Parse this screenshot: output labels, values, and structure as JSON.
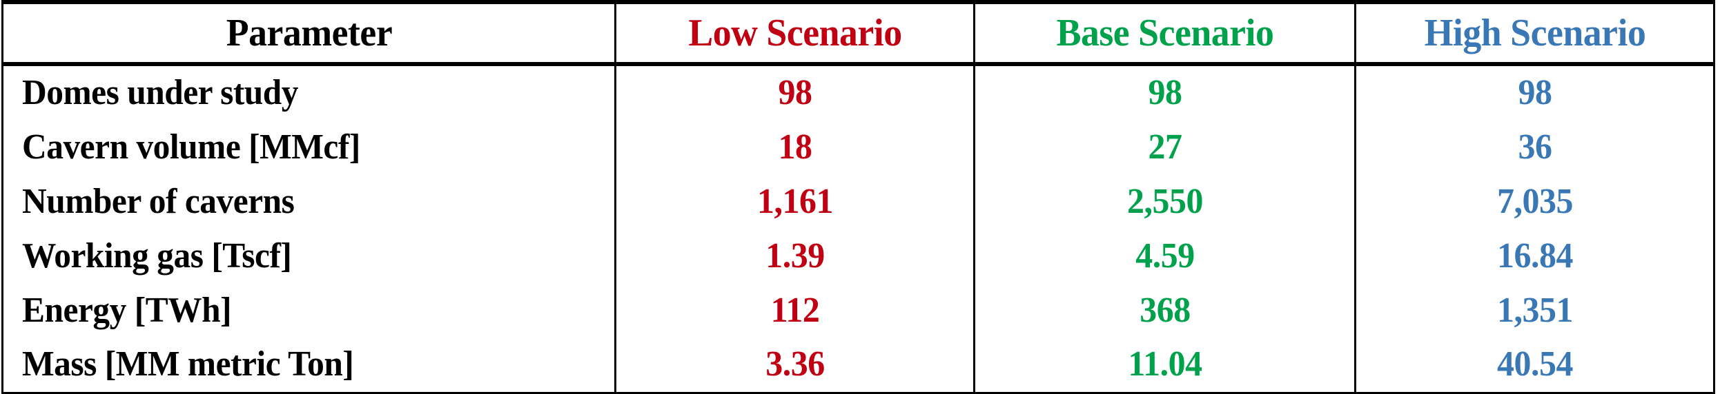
{
  "table": {
    "columns": [
      {
        "key": "parameter",
        "label": "Parameter",
        "color": "#000000",
        "align": "left"
      },
      {
        "key": "low",
        "label": "Low Scenario",
        "color": "#c00012",
        "align": "center"
      },
      {
        "key": "base",
        "label": "Base Scenario",
        "color": "#00a14b",
        "align": "center"
      },
      {
        "key": "high",
        "label": "High Scenario",
        "color": "#3a78b5",
        "align": "center"
      }
    ],
    "rows": [
      {
        "parameter": "Domes under study",
        "low": "98",
        "base": "98",
        "high": "98"
      },
      {
        "parameter": "Cavern volume [MMcf]",
        "low": "18",
        "base": "27",
        "high": "36"
      },
      {
        "parameter": "Number of caverns",
        "low": "1,161",
        "base": "2,550",
        "high": "7,035"
      },
      {
        "parameter": "Working gas [Tscf]",
        "low": "1.39",
        "base": "4.59",
        "high": "16.84"
      },
      {
        "parameter": "Energy [TWh]",
        "low": "112",
        "base": "368",
        "high": "1,351"
      },
      {
        "parameter": "Mass [MM metric Ton]",
        "low": "3.36",
        "base": "11.04",
        "high": "40.54"
      }
    ]
  },
  "chart_data": {
    "type": "table",
    "title": "",
    "categories": [
      "Domes under study",
      "Cavern volume [MMcf]",
      "Number of caverns",
      "Working gas [Tscf]",
      "Energy [TWh]",
      "Mass [MM metric Ton]"
    ],
    "series": [
      {
        "name": "Low Scenario",
        "color": "#c00012",
        "values": [
          98,
          18,
          1161,
          1.39,
          112,
          3.36
        ]
      },
      {
        "name": "Base Scenario",
        "color": "#00a14b",
        "values": [
          98,
          27,
          2550,
          4.59,
          368,
          11.04
        ]
      },
      {
        "name": "High Scenario",
        "color": "#3a78b5",
        "values": [
          98,
          36,
          7035,
          16.84,
          1351,
          40.54
        ]
      }
    ],
    "xlabel": "Parameter",
    "ylabel": "",
    "legend_position": "header-row",
    "grid": true
  }
}
